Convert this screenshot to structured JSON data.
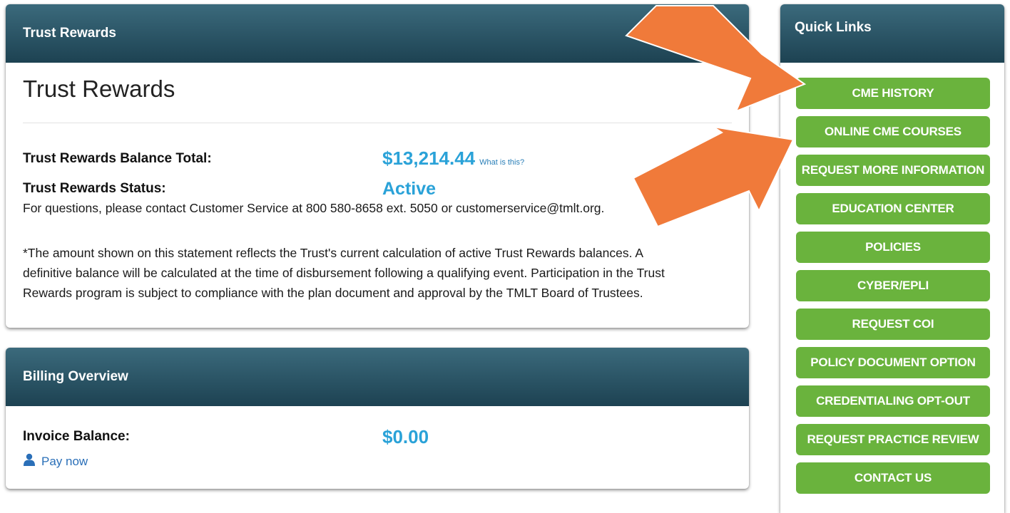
{
  "trust_rewards": {
    "header": "Trust Rewards",
    "title": "Trust Rewards",
    "balance_label": "Trust Rewards Balance Total:",
    "balance_value": "$13,214.44",
    "what_is_this": "What is this?",
    "status_label": "Trust Rewards Status:",
    "status_value": "Active",
    "contact_text": "For questions, please contact Customer Service at 800 580-8658 ext. 5050 or customerservice@tmlt.org.",
    "disclaimer_lines": [
      "*The amount shown on this statement reflects the Trust's current calculation of active Trust Rewards balances. A",
      "definitive balance will be calculated at the time of disbursement following a qualifying event. Participation in the Trust",
      "Rewards program is subject to compliance with the plan document and approval by the TMLT Board of Trustees."
    ]
  },
  "billing": {
    "header": "Billing Overview",
    "invoice_label": "Invoice Balance:",
    "invoice_value": "$0.00",
    "pay_now": "Pay now"
  },
  "quick_links": {
    "header": "Quick Links",
    "items": [
      "CME HISTORY",
      "ONLINE CME COURSES",
      "REQUEST MORE INFORMATION",
      "EDUCATION CENTER",
      "POLICIES",
      "CYBER/EPLI",
      "REQUEST COI",
      "POLICY DOCUMENT OPTION",
      "CREDENTIALING OPT-OUT",
      "REQUEST PRACTICE REVIEW",
      "CONTACT US"
    ]
  },
  "colors": {
    "header_gradient_top": "#3b6a7c",
    "header_gradient_bottom": "#1d4252",
    "accent_blue": "#2aa2d8",
    "button_green": "#6ab33d",
    "arrow_orange": "#f07a3a"
  },
  "icons": [
    "user-icon",
    "annotation-arrow"
  ]
}
